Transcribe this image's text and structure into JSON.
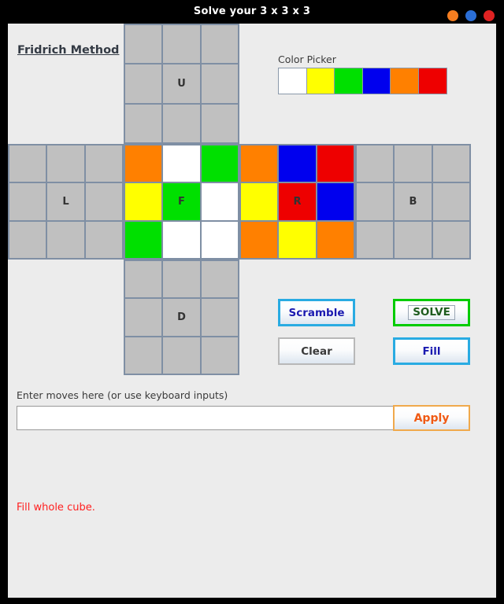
{
  "window": {
    "title": "Solve your 3 x 3 x 3",
    "buttons": [
      {
        "name": "minimize",
        "color": "#f47d20"
      },
      {
        "name": "maximize",
        "color": "#2a6ed6"
      },
      {
        "name": "close",
        "color": "#e02222"
      }
    ]
  },
  "method_link": {
    "label": "Fridrich Method"
  },
  "color_picker": {
    "label": "Color Picker",
    "swatches": [
      {
        "name": "white",
        "hex": "#ffffff"
      },
      {
        "name": "yellow",
        "hex": "#ffff00"
      },
      {
        "name": "green",
        "hex": "#00e000"
      },
      {
        "name": "blue",
        "hex": "#0000ee"
      },
      {
        "name": "orange",
        "hex": "#ff8000"
      },
      {
        "name": "red",
        "hex": "#ee0000"
      }
    ]
  },
  "cube": {
    "empty_color": "#c0c0c0",
    "faces": [
      {
        "id": "U",
        "center_label": "U",
        "cells": [
          "gray",
          "gray",
          "gray",
          "gray",
          "gray",
          "gray",
          "gray",
          "gray",
          "gray"
        ]
      },
      {
        "id": "L",
        "center_label": "L",
        "cells": [
          "gray",
          "gray",
          "gray",
          "gray",
          "gray",
          "gray",
          "gray",
          "gray",
          "gray"
        ]
      },
      {
        "id": "F",
        "center_label": "F",
        "cells": [
          "orange",
          "white",
          "green",
          "yellow",
          "green",
          "white",
          "green",
          "white",
          "white"
        ]
      },
      {
        "id": "R",
        "center_label": "R",
        "cells": [
          "orange",
          "blue",
          "red",
          "yellow",
          "red",
          "blue",
          "orange",
          "yellow",
          "orange"
        ]
      },
      {
        "id": "B",
        "center_label": "B",
        "cells": [
          "gray",
          "gray",
          "gray",
          "gray",
          "gray",
          "gray",
          "gray",
          "gray",
          "gray"
        ]
      },
      {
        "id": "D",
        "center_label": "D",
        "cells": [
          "gray",
          "gray",
          "gray",
          "gray",
          "gray",
          "gray",
          "gray",
          "gray",
          "gray"
        ]
      }
    ]
  },
  "actions": {
    "scramble_label": "Scramble",
    "solve_label": "SOLVE",
    "clear_label": "Clear",
    "fill_label": "Fill",
    "apply_label": "Apply"
  },
  "moves": {
    "label": "Enter moves here (or use keyboard inputs)",
    "value": "",
    "placeholder": ""
  },
  "status": {
    "message": "Fill whole cube."
  },
  "colors": {
    "accent_blue": "#29abe2",
    "accent_green": "#00cc00",
    "accent_orange": "#f0a94c",
    "status_red": "#ff2020",
    "grid_line": "#7f8fa4"
  }
}
